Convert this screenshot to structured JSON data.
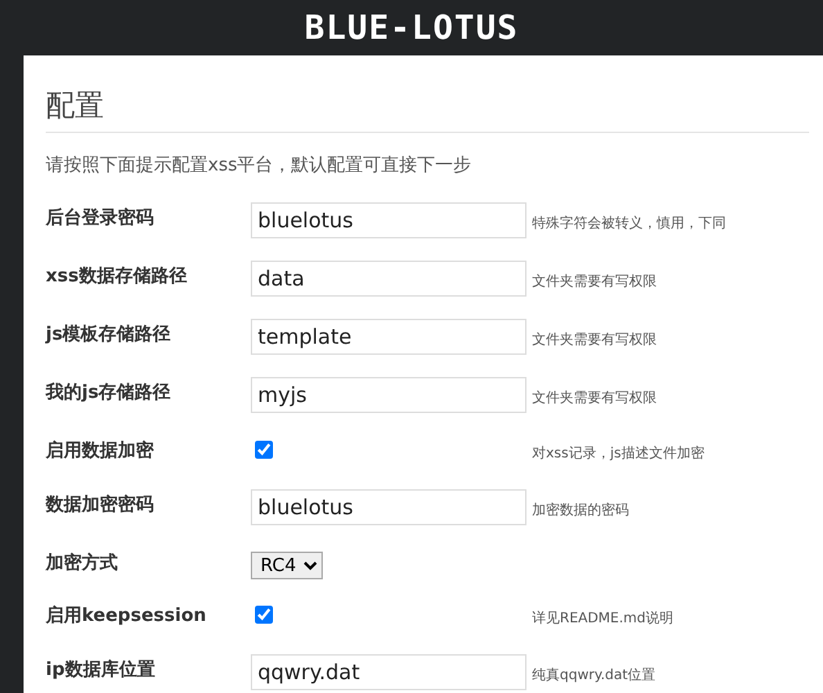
{
  "header": {
    "title": "BLUE-LOTUS"
  },
  "page": {
    "heading": "配置",
    "intro": "请按照下面提示配置xss平台，默认配置可直接下一步"
  },
  "fields": [
    {
      "kind": "text",
      "label": "后台登录密码",
      "value": "bluelotus",
      "hint": "特殊字符会被转义，慎用，下同"
    },
    {
      "kind": "text",
      "label": "xss数据存储路径",
      "value": "data",
      "hint": "文件夹需要有写权限"
    },
    {
      "kind": "text",
      "label": "js模板存储路径",
      "value": "template",
      "hint": "文件夹需要有写权限"
    },
    {
      "kind": "text",
      "label": "我的js存储路径",
      "value": "myjs",
      "hint": "文件夹需要有写权限"
    },
    {
      "kind": "checkbox",
      "label": "启用数据加密",
      "checked": true,
      "hint": "对xss记录，js描述文件加密"
    },
    {
      "kind": "text",
      "label": "数据加密密码",
      "value": "bluelotus",
      "hint": "加密数据的密码"
    },
    {
      "kind": "select",
      "label": "加密方式",
      "value": "RC4"
    },
    {
      "kind": "checkbox",
      "label": "启用keepsession",
      "checked": true,
      "hint": "详见README.md说明"
    },
    {
      "kind": "text",
      "label": "ip数据库位置",
      "value": "qqwry.dat",
      "hint": "纯真qqwry.dat位置"
    }
  ]
}
